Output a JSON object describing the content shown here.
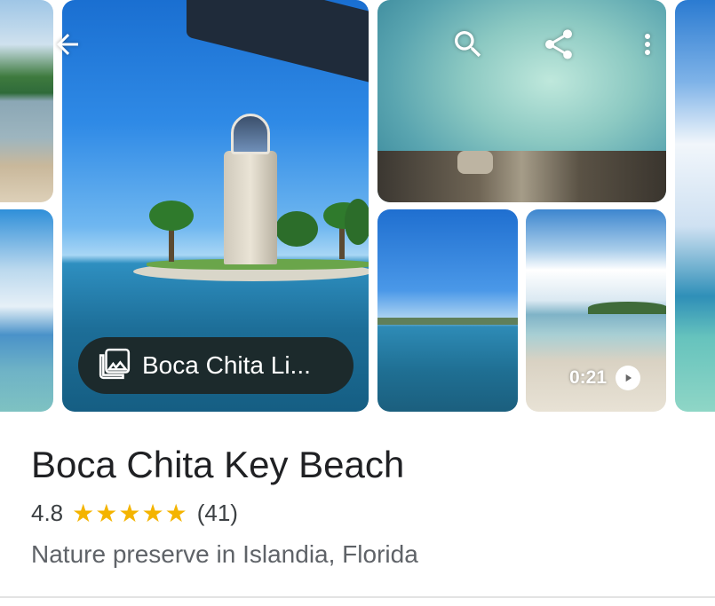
{
  "toolbar": {
    "back_icon": "arrow-back-icon",
    "search_icon": "search-icon",
    "share_icon": "share-icon",
    "more_icon": "more-vert-icon"
  },
  "gallery": {
    "chip_label": "Boca Chita Li...",
    "chip_icon": "photo-library-icon",
    "video_duration": "0:21",
    "video_icon": "play-icon"
  },
  "place": {
    "name": "Boca Chita Key Beach",
    "rating": "4.8",
    "stars": 5,
    "review_count": "(41)",
    "category": "Nature preserve in Islandia, Florida"
  },
  "colors": {
    "star": "#f4b400",
    "title": "#202124",
    "chip_bg": "#1c2a2c"
  }
}
